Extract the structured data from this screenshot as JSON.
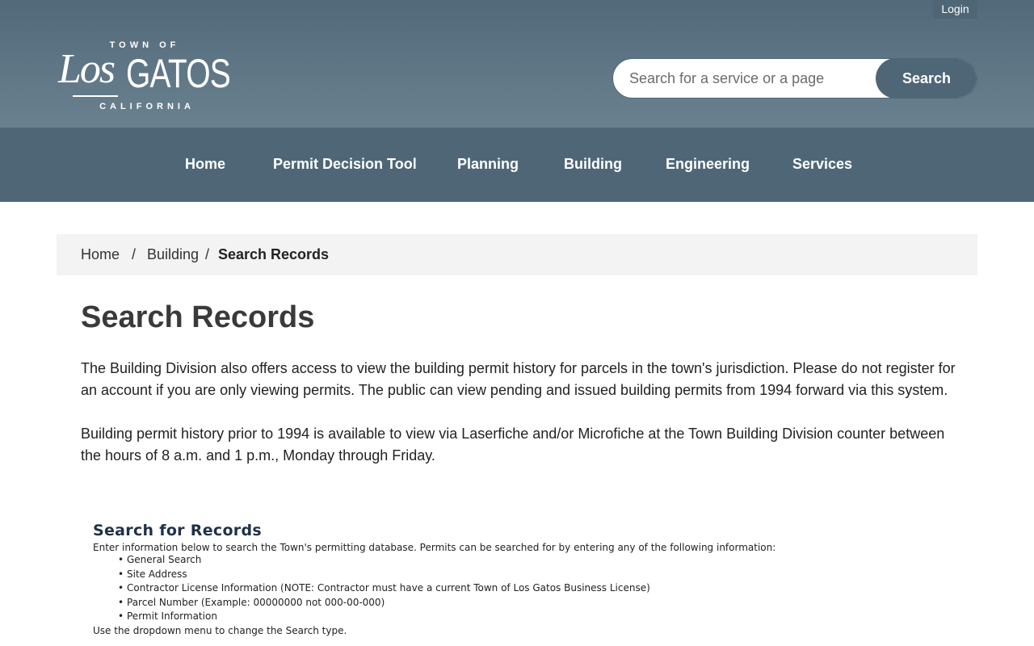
{
  "header": {
    "login_label": "Login",
    "logo": {
      "top_text": "TOWN OF",
      "los_text": "Los",
      "gatos_text": "GATOS",
      "bottom_text": "CALIFORNIA"
    },
    "search": {
      "placeholder": "Search for a service or a page",
      "button_label": "Search"
    }
  },
  "nav": {
    "items": [
      {
        "label": "Home"
      },
      {
        "label": "Permit Decision Tool"
      },
      {
        "label": "Planning"
      },
      {
        "label": "Building"
      },
      {
        "label": "Engineering"
      },
      {
        "label": "Services"
      }
    ]
  },
  "breadcrumb": {
    "home": "Home",
    "separator": "/",
    "building": "Building",
    "current": "Search Records"
  },
  "main": {
    "title": "Search Records",
    "paragraph1": "The Building Division also offers access to view the building permit history for parcels in the town's jurisdiction. Please do not register for an account if you are only viewing permits. The public can view pending and issued building permits from 1994 forward via this system.",
    "paragraph2": "Building permit history prior to 1994 is available to view via Laserfiche and/or Microfiche at the Town Building Division counter between the hours of 8 a.m. and 1 p.m., Monday through Friday."
  },
  "records": {
    "title": "Search for Records",
    "intro": "Enter information below to search the Town's permitting database. Permits can be searched for by entering any of the following information:",
    "bullet": "•",
    "items": [
      "General Search",
      "Site Address",
      "Contractor License Information (NOTE: Contractor must have a current Town of Los Gatos Business License)",
      "Parcel Number (Example: 00000000 not 000-00-000)",
      "Permit Information"
    ],
    "footer": "Use the dropdown menu to change the Search type."
  },
  "colors": {
    "header_top": "#52697a",
    "nav_bg": "#4f6677",
    "breadcrumb_bg": "#f3f3f3",
    "records_title": "#1f3148"
  }
}
